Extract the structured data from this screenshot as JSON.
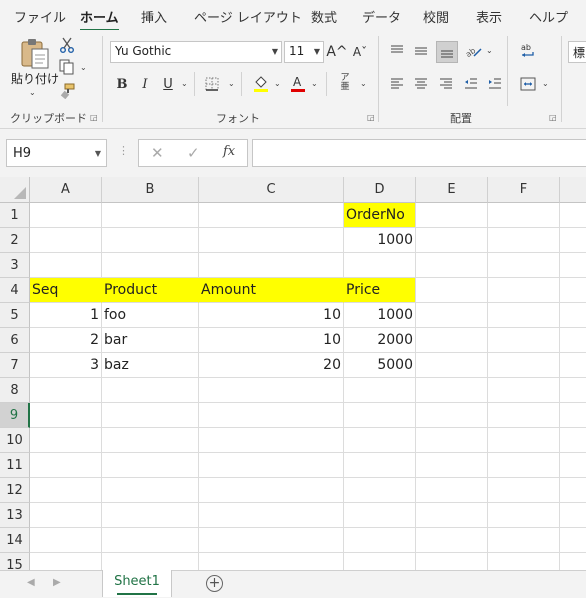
{
  "tabs": [
    "ファイル",
    "ホーム",
    "挿入",
    "ページ レイアウト",
    "数式",
    "データ",
    "校閲",
    "表示",
    "ヘルプ"
  ],
  "active_tab": "ホーム",
  "ribbon": {
    "clipboard": {
      "paste_label": "貼り付け",
      "group_label": "クリップボード"
    },
    "font": {
      "font_name": "Yu Gothic",
      "font_size": "11",
      "group_label": "フォント",
      "bold": "B",
      "italic": "I",
      "underline": "U",
      "grow": "A^",
      "shrink": "Aˇ",
      "highlight_color": "#ffff00",
      "font_color": "#e00000"
    },
    "alignment": {
      "group_label": "配置"
    },
    "partial_right_text": "標"
  },
  "formula_bar": {
    "name_box": "H9",
    "fx": "fx",
    "formula": ""
  },
  "columns": [
    "A",
    "B",
    "C",
    "D",
    "E",
    "F"
  ],
  "rows": [
    "1",
    "2",
    "3",
    "4",
    "5",
    "6",
    "7",
    "8",
    "9",
    "10",
    "11",
    "12",
    "13",
    "14",
    "15"
  ],
  "selected_row": "9",
  "cells": {
    "D1": "OrderNo",
    "D2": "1000",
    "A4": "Seq",
    "B4": "Product",
    "C4": "Amount",
    "D4": "Price",
    "A5": "1",
    "B5": "foo",
    "C5": "10",
    "D5": "1000",
    "A6": "2",
    "B6": "bar",
    "C6": "10",
    "D6": "2000",
    "A7": "3",
    "B7": "baz",
    "C7": "20",
    "D7": "5000"
  },
  "highlight_color": "#ffff00",
  "accent_color": "#217346",
  "sheet_tabs": [
    "Sheet1"
  ],
  "add_sheet_symbol": "+"
}
